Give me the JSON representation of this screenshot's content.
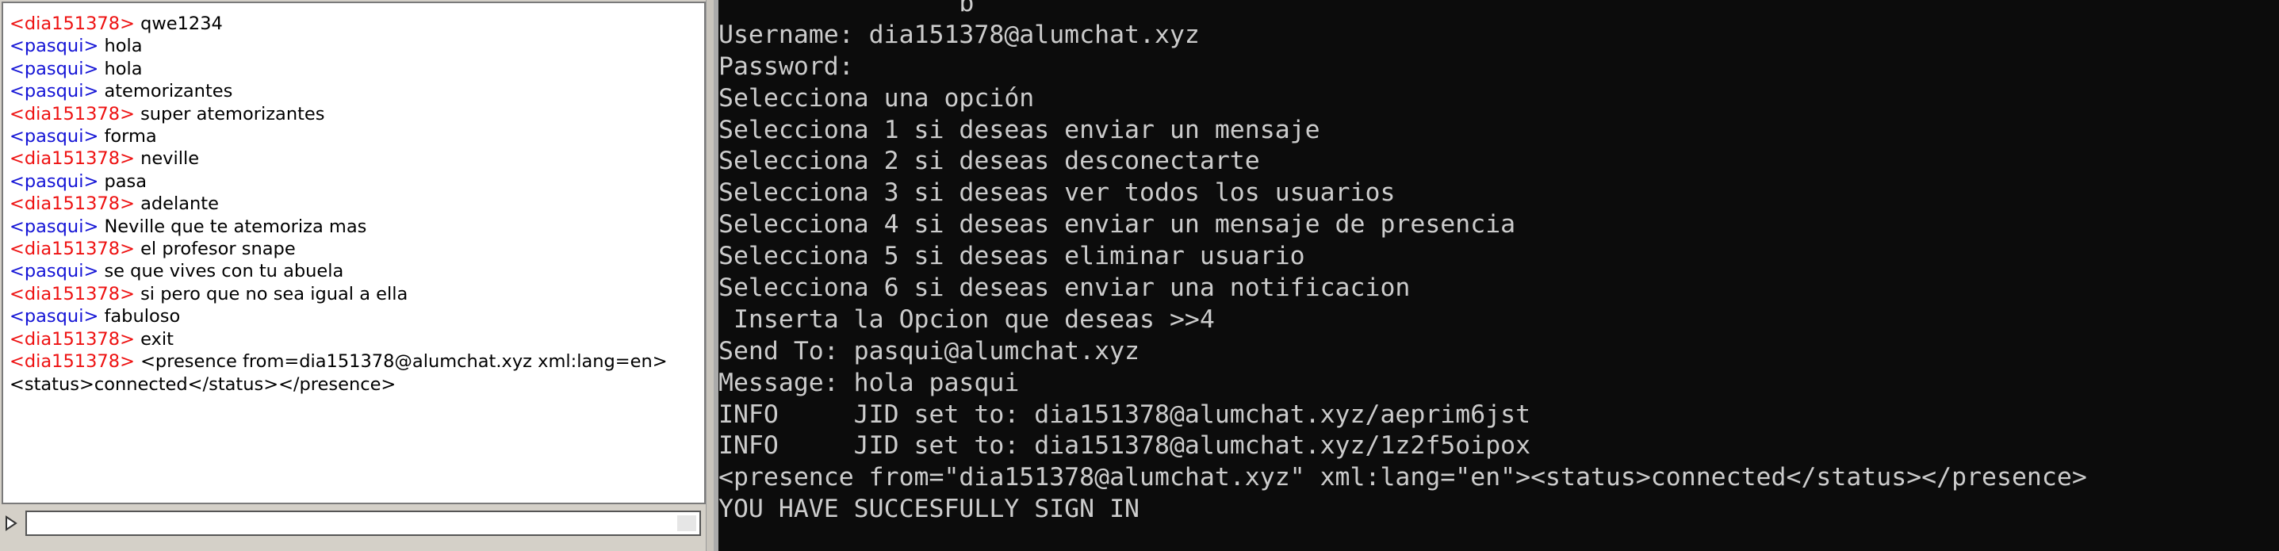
{
  "chat_client": {
    "messages": [
      {
        "nick": "<dia151378>",
        "from": "self",
        "text": " qwe1234"
      },
      {
        "nick": "<pasqui>",
        "from": "peer",
        "text": " hola"
      },
      {
        "nick": "<pasqui>",
        "from": "peer",
        "text": " hola"
      },
      {
        "nick": "<pasqui>",
        "from": "peer",
        "text": " atemorizantes"
      },
      {
        "nick": "<dia151378>",
        "from": "self",
        "text": " super atemorizantes"
      },
      {
        "nick": "<pasqui>",
        "from": "peer",
        "text": " forma"
      },
      {
        "nick": "<dia151378>",
        "from": "self",
        "text": " neville"
      },
      {
        "nick": "<pasqui>",
        "from": "peer",
        "text": " pasa"
      },
      {
        "nick": "<dia151378>",
        "from": "self",
        "text": " adelante"
      },
      {
        "nick": "<pasqui>",
        "from": "peer",
        "text": " Neville que te atemoriza mas"
      },
      {
        "nick": "<dia151378>",
        "from": "self",
        "text": " el profesor snape"
      },
      {
        "nick": "<pasqui>",
        "from": "peer",
        "text": " se que vives con tu abuela"
      },
      {
        "nick": "<dia151378>",
        "from": "self",
        "text": " si pero que no sea igual a ella"
      },
      {
        "nick": "<pasqui>",
        "from": "peer",
        "text": " fabuloso"
      },
      {
        "nick": "<dia151378>",
        "from": "self",
        "text": " exit"
      },
      {
        "nick": "<dia151378>",
        "from": "self",
        "text": " <presence from=dia151378@alumchat.xyz xml:lang=en><status>connected</status></presence>"
      }
    ],
    "input_value": ""
  },
  "colors": {
    "self_nick": "#ee1111",
    "peer_nick": "#1414d6",
    "terminal_bg": "#0c0c0c",
    "terminal_fg": "#cccccc"
  },
  "terminal": {
    "lines": [
      "                b",
      "Username: dia151378@alumchat.xyz",
      "Password:",
      "Selecciona una opción",
      "Selecciona 1 si deseas enviar un mensaje",
      "Selecciona 2 si deseas desconectarte",
      "Selecciona 3 si deseas ver todos los usuarios",
      "Selecciona 4 si deseas enviar un mensaje de presencia",
      "Selecciona 5 si deseas eliminar usuario",
      "Selecciona 6 si deseas enviar una notificacion",
      " Inserta la Opcion que deseas >>4",
      "Send To: pasqui@alumchat.xyz",
      "Message: hola pasqui",
      "INFO     JID set to: dia151378@alumchat.xyz/aeprim6jst",
      "INFO     JID set to: dia151378@alumchat.xyz/1z2f5oipox",
      "<presence from=\"dia151378@alumchat.xyz\" xml:lang=\"en\"><status>connected</status></presence>",
      "YOU HAVE SUCCESFULLY SIGN IN"
    ]
  }
}
